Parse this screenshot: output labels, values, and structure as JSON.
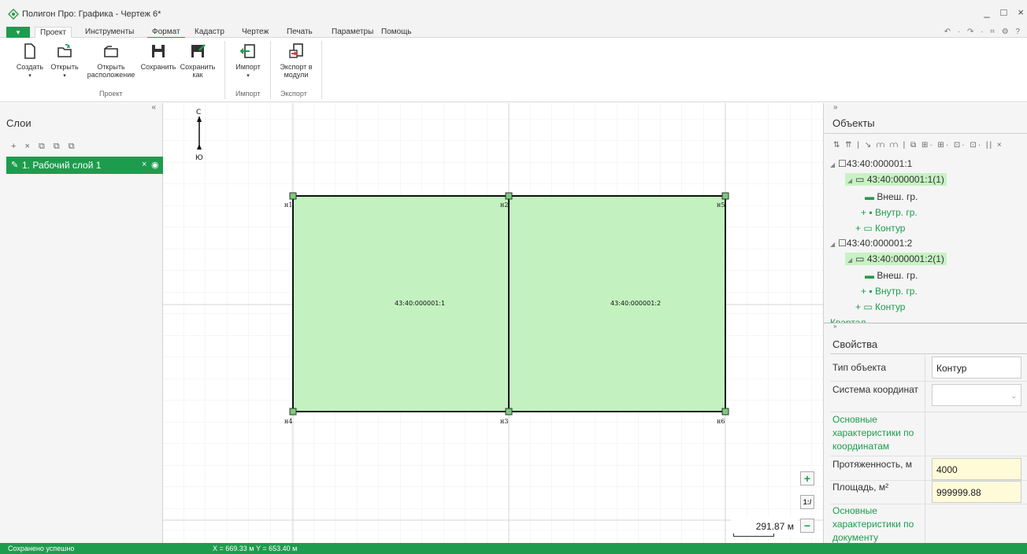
{
  "window": {
    "title": "Полигон Про: Графика - Чертеж 6*",
    "controls": [
      "_",
      "□",
      "×"
    ]
  },
  "menu": {
    "file_tab": "▾",
    "tabs": [
      "Проект",
      "Инструменты",
      "Формат",
      "Кадастр",
      "Чертеж",
      "Печать",
      "Параметры",
      "Помощь"
    ],
    "quick_access": "↶ · ↷ · ⌗ ⚙ ?"
  },
  "ribbon": {
    "buttons": {
      "create": "Создать",
      "open": "Открыть",
      "open_location_1": "Открыть",
      "open_location_2": "расположение",
      "save": "Сохранить",
      "save_as_1": "Сохранить",
      "save_as_2": "как",
      "import": "Импорт",
      "export_1": "Экспорт в",
      "export_2": "модули"
    },
    "groups": [
      "Проект",
      "Импорт",
      "Экспорт"
    ]
  },
  "layers_panel": {
    "collapse": "«",
    "title": "Слои",
    "tools": "+ × ⧉ ⧉ ⧉",
    "layers": [
      {
        "label": "1. Рабочий слой 1"
      }
    ]
  },
  "canvas": {
    "compass_north": "С",
    "compass_south": "Ю",
    "parcels": [
      "43:40:000001:1",
      "43:40:000001:2"
    ],
    "points": [
      "н1",
      "н2",
      "н5",
      "н4",
      "н3",
      "н6"
    ],
    "scale": "291.87 м",
    "zoom_in": "+",
    "zoom_reset": "1:/",
    "zoom_out": "−"
  },
  "objects_panel": {
    "collapse": "»",
    "title": "Объекты",
    "tools": "⇅ ⇈ | ↘ ⩋ ⩋ | ⧉ ⊞· ⊞· ⊡· ⊡· || ×",
    "tree": [
      {
        "label": "43:40:000001:1"
      },
      {
        "label": "43:40:000001:1(1)"
      },
      {
        "label": "Внеш. гр."
      },
      {
        "label": "Внутр. гр."
      },
      {
        "label": "Контур"
      },
      {
        "label": "43:40:000001:2"
      },
      {
        "label": "43:40:000001:2(1)"
      },
      {
        "label": "Внеш. гр."
      },
      {
        "label": "Внутр. гр."
      },
      {
        "label": "Контур"
      },
      {
        "label": "Квартал"
      }
    ]
  },
  "properties_panel": {
    "collapse": "»",
    "title": "Свойства",
    "object_type_label": "Тип объекта",
    "object_type_value": "Контур",
    "coord_system_label": "Система координат",
    "coord_system_value": "",
    "section_by_coords": "Основные характеристики по координатам",
    "length_label": "Протяженность, м",
    "length_value": "4000",
    "area_label": "Площадь, м²",
    "area_value": "999999.88",
    "section_by_doc": "Основные характеристики по документу"
  },
  "status": {
    "message": "Сохранено успешно",
    "coords": "X = 669.33 м   Y = 653.40 м"
  },
  "colors": {
    "accent": "#1e9c4e",
    "parcel_fill": "#c3f2c0",
    "highlight": "#c8f2c4",
    "field_highlight": "#fffbd8"
  }
}
